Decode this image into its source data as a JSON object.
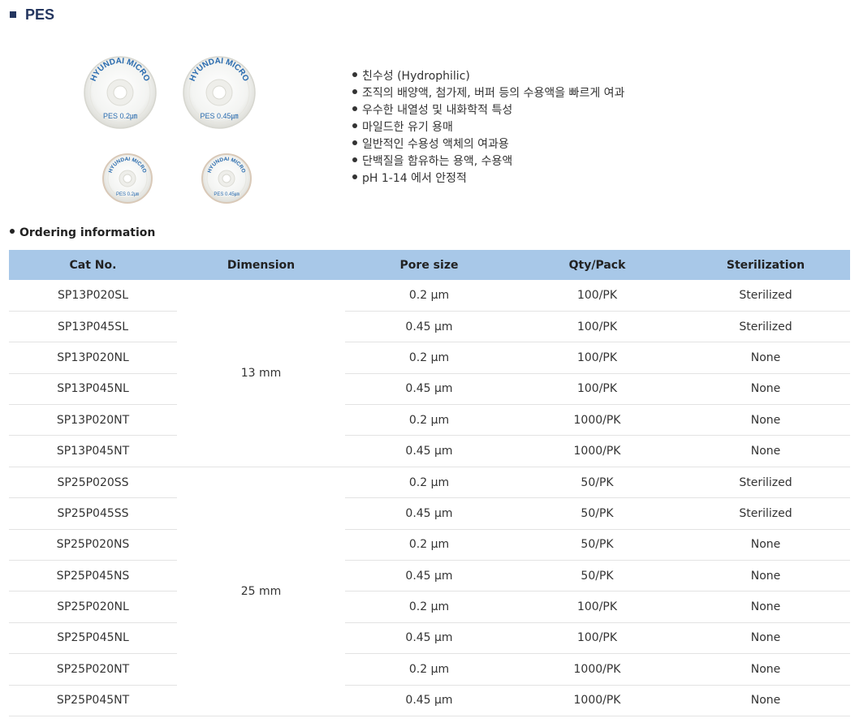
{
  "section": {
    "title": "PES"
  },
  "product_image": {
    "large_left": {
      "brand": "HYUNDAI MICRO",
      "label": "PES 0.2㎛"
    },
    "large_right": {
      "brand": "HYUNDAI MICRO",
      "label": "PES 0.45㎛"
    },
    "small_left": {
      "brand": "HYUNDAI MICRO",
      "label": "PES 0.2㎛"
    },
    "small_right": {
      "brand": "HYUNDAI MICRO",
      "label": "PES 0.45㎛"
    }
  },
  "features": [
    "친수성 (Hydrophilic)",
    "조직의 배양액, 첨가제, 버퍼 등의 수용액을 빠르게 여과",
    "우수한 내열성 및 내화학적 특성",
    "마일드한 유기 용매",
    "일반적인 수용성 액체의 여과용",
    "단백질을 함유하는 용액, 수용액",
    "pH 1-14 에서 안정적"
  ],
  "ordering": {
    "heading": "Ordering information",
    "columns": [
      "Cat No.",
      "Dimension",
      "Pore size",
      "Qty/Pack",
      "Sterilization"
    ],
    "rows": [
      {
        "cat": "SP13P020SL",
        "dimension": "13 mm",
        "pore": "0.2 μm",
        "qty": "100/PK",
        "steril": "Sterilized"
      },
      {
        "cat": "SP13P045SL",
        "pore": "0.45 μm",
        "qty": "100/PK",
        "steril": "Sterilized"
      },
      {
        "cat": "SP13P020NL",
        "pore": "0.2 μm",
        "qty": "100/PK",
        "steril": "None"
      },
      {
        "cat": "SP13P045NL",
        "pore": "0.45 μm",
        "qty": "100/PK",
        "steril": "None"
      },
      {
        "cat": "SP13P020NT",
        "pore": "0.2 μm",
        "qty": "1000/PK",
        "steril": "None"
      },
      {
        "cat": "SP13P045NT",
        "pore": "0.45 μm",
        "qty": "1000/PK",
        "steril": "None"
      },
      {
        "cat": "SP25P020SS",
        "dimension": "25 mm",
        "pore": "0.2 μm",
        "qty": "50/PK",
        "steril": "Sterilized"
      },
      {
        "cat": "SP25P045SS",
        "pore": "0.45 μm",
        "qty": "50/PK",
        "steril": "Sterilized"
      },
      {
        "cat": "SP25P020NS",
        "pore": "0.2 μm",
        "qty": "50/PK",
        "steril": "None"
      },
      {
        "cat": "SP25P045NS",
        "pore": "0.45 μm",
        "qty": "50/PK",
        "steril": "None"
      },
      {
        "cat": "SP25P020NL",
        "pore": "0.2 μm",
        "qty": "100/PK",
        "steril": "None"
      },
      {
        "cat": "SP25P045NL",
        "pore": "0.45 μm",
        "qty": "100/PK",
        "steril": "None"
      },
      {
        "cat": "SP25P020NT",
        "pore": "0.2 μm",
        "qty": "1000/PK",
        "steril": "None"
      },
      {
        "cat": "SP25P045NT",
        "pore": "0.45 μm",
        "qty": "1000/PK",
        "steril": "None"
      }
    ]
  },
  "colors": {
    "title": "#24365f",
    "header_bg": "#a8c8e8",
    "brand_blue": "#2a6cb0"
  }
}
